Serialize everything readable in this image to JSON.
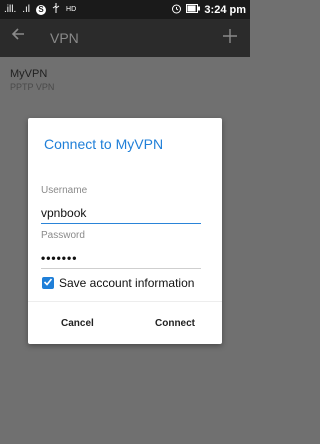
{
  "status_bar": {
    "signal_label": ".ill.",
    "network_label": ".ıl",
    "skype_icon": "S",
    "usb_icon": "usb",
    "hd_label": "HD",
    "battery_level_pct": 90,
    "time": "3:24 pm"
  },
  "toolbar": {
    "title": "VPN",
    "back_icon": "arrow-left",
    "add_icon": "plus"
  },
  "vpn_list": [
    {
      "name": "MyVPN",
      "type": "PPTP VPN"
    }
  ],
  "dialog": {
    "title": "Connect to MyVPN",
    "username_label": "Username",
    "username_value": "vpnbook",
    "password_label": "Password",
    "password_value": "•••••••",
    "save_label": "Save account information",
    "save_checked": true,
    "cancel_label": "Cancel",
    "connect_label": "Connect"
  },
  "colors": {
    "accent": "#1f7fd8",
    "scrim": "#707070",
    "toolbar": "#2b2b2b"
  }
}
